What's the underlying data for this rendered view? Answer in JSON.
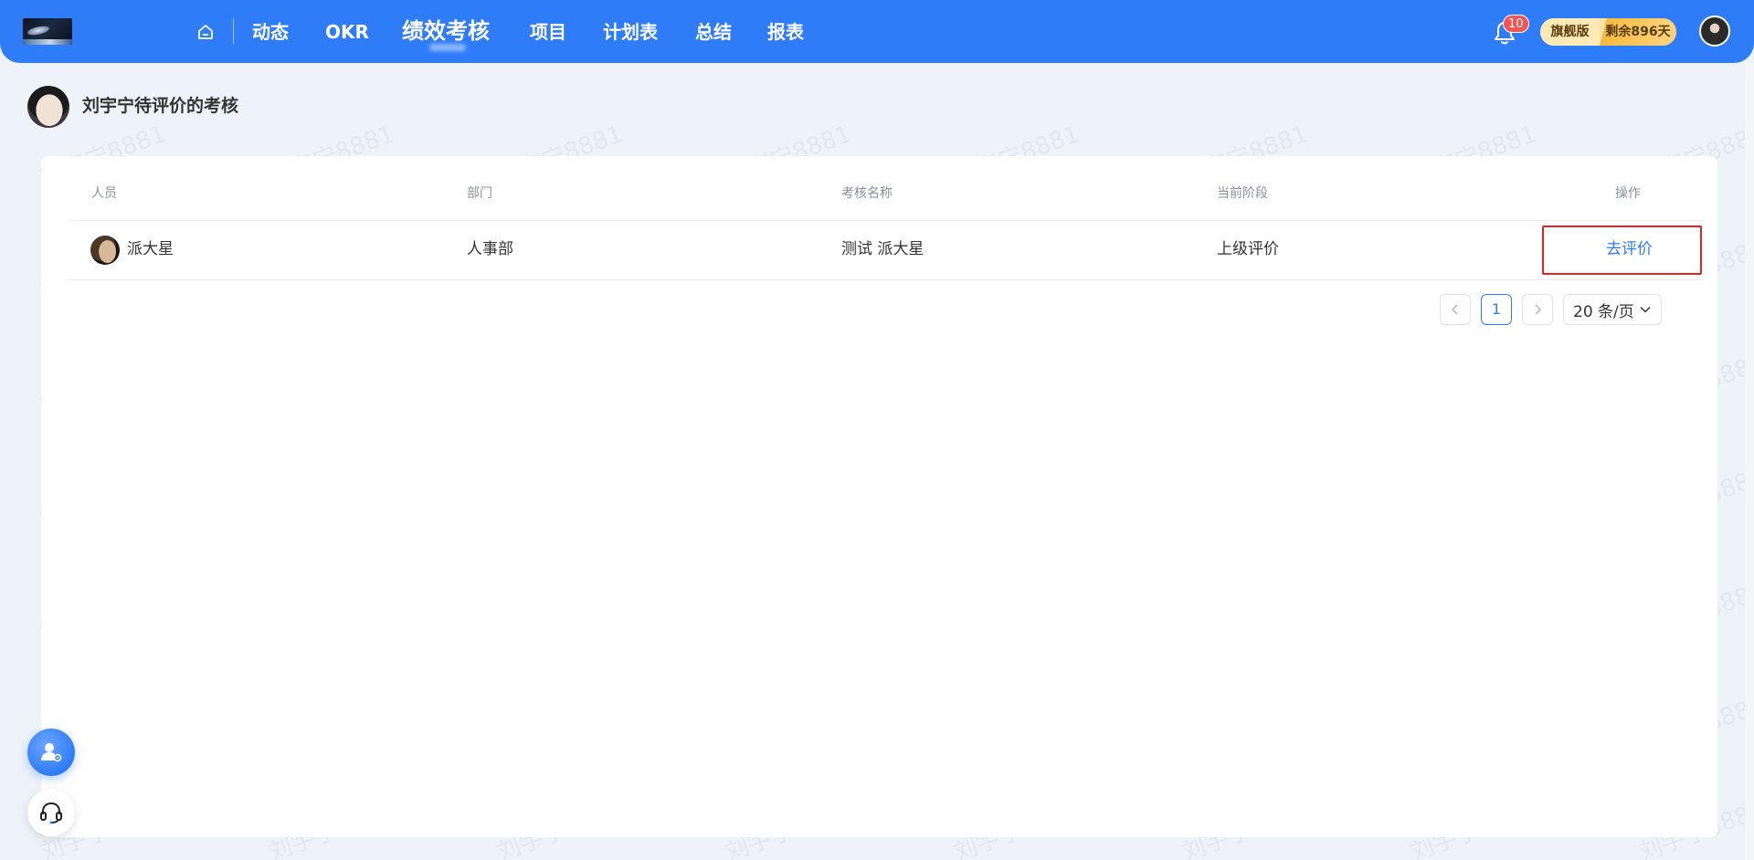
{
  "nav": {
    "items": [
      "动态",
      "OKR",
      "绩效考核",
      "项目",
      "计划表",
      "总结",
      "报表"
    ],
    "active_index": 2,
    "notification_count": "10",
    "plan_label": "旗舰版",
    "plan_remaining": "剩余896天"
  },
  "page": {
    "title": "刘宇宁待评价的考核"
  },
  "table": {
    "headers": [
      "人员",
      "部门",
      "考核名称",
      "当前阶段",
      "操作"
    ],
    "rows": [
      {
        "person": "派大星",
        "department": "人事部",
        "review_name": "测试 派大星",
        "stage": "上级评价",
        "action": "去评价"
      }
    ]
  },
  "pagination": {
    "current_page": "1",
    "page_size": "20 条/页"
  },
  "watermark": "刘宇宁8881",
  "colors": {
    "primary": "#2f7cf8",
    "highlight_border": "#e02424",
    "badge": "#f25555"
  }
}
